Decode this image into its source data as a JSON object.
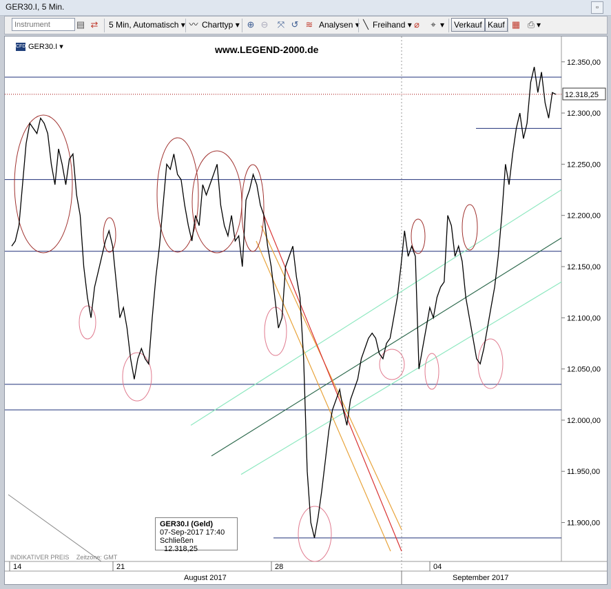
{
  "window": {
    "title": "GER30.I, 5 Min."
  },
  "toolbar": {
    "instrument_placeholder": "Instrument",
    "interval_label": "5 Min,  Automatisch",
    "charttype_label": "Charttyp",
    "analysis_label": "Analysen",
    "freehand_label": "Freihand",
    "sell_label": "Verkauf",
    "buy_label": "Kauf"
  },
  "chart_header": {
    "instrument_name": "GER30.I",
    "website": "www.LEGEND-2000.de"
  },
  "price_tag": "12.318,25",
  "infobox": {
    "title": "GER30.I (Geld)",
    "datetime": "07-Sep-2017 17:40",
    "close_label": "Schließen",
    "close_value": "12.318,25"
  },
  "footer_note": {
    "indicative": "INDIKATIVER PREIS",
    "timezone": "Zeitzone: GMT"
  },
  "colors": {
    "price_line": "#000000",
    "horizontal_levels": "#1e2f78",
    "red_dotted_line": "#a00000",
    "circles": "#a0322f",
    "pink_circles": "#e07a8e",
    "trend_light": "#8ee8c0",
    "trend_dark": "#2e6a4e",
    "fan_orange": "#e8a33a",
    "fan_red": "#d93232"
  },
  "chart_data": {
    "type": "line",
    "title": "GER30.I, 5 Min.",
    "xlabel": "",
    "ylabel": "",
    "ylim": [
      11862,
      12368
    ],
    "y_ticks": [
      "12.350,00",
      "12.300,00",
      "12.250,00",
      "12.200,00",
      "12.150,00",
      "12.100,00",
      "12.050,00",
      "12.000,00",
      "11.950,00",
      "11.900,00"
    ],
    "x_ticks": [
      "14",
      "21",
      "28",
      "04"
    ],
    "x_groups": [
      "August 2017",
      "September 2017"
    ],
    "last_close": 12318.25,
    "series": [
      {
        "values": [
          12170,
          12175,
          12190,
          12230,
          12270,
          12290,
          12285,
          12280,
          12295,
          12290,
          12280,
          12250,
          12230,
          12265,
          12250,
          12230,
          12255,
          12260,
          12220,
          12200,
          12150,
          12120,
          12100,
          12130,
          12145,
          12160,
          12175,
          12185,
          12170,
          12135,
          12100,
          12110,
          12090,
          12060,
          12040,
          12060,
          12070,
          12060,
          12055,
          12100,
          12140,
          12170,
          12210,
          12250,
          12245,
          12260,
          12240,
          12235,
          12210,
          12190,
          12175,
          12200,
          12190,
          12230,
          12220,
          12230,
          12240,
          12250,
          12210,
          12190,
          12180,
          12200,
          12175,
          12180,
          12150,
          12215,
          12225,
          12240,
          12230,
          12210,
          12200,
          12170,
          12150,
          12120,
          12090,
          12100,
          12150,
          12160,
          12170,
          12140,
          12120,
          12060,
          11950,
          11900,
          11885,
          11905,
          11930,
          11960,
          11990,
          12010,
          12020,
          12030,
          12010,
          11995,
          12020,
          12030,
          12040,
          12060,
          12070,
          12080,
          12085,
          12080,
          12065,
          12060,
          12075,
          12080,
          12100,
          12120,
          12150,
          12185,
          12160,
          12170,
          12160,
          12050,
          12070,
          12090,
          12110,
          12100,
          12120,
          12130,
          12135,
          12200,
          12190,
          12160,
          12170,
          12155,
          12120,
          12100,
          12080,
          12060,
          12055,
          12070,
          12090,
          12110,
          12130,
          12160,
          12200,
          12250,
          12230,
          12260,
          12285,
          12300,
          12275,
          12290,
          12330,
          12345,
          12320,
          12340,
          12310,
          12295,
          12320,
          12318.25
        ]
      }
    ],
    "horizontal_levels": [
      12335,
      12235,
      12165,
      12035,
      12010,
      11885
    ],
    "short_levels": [
      12285,
      11885
    ]
  }
}
